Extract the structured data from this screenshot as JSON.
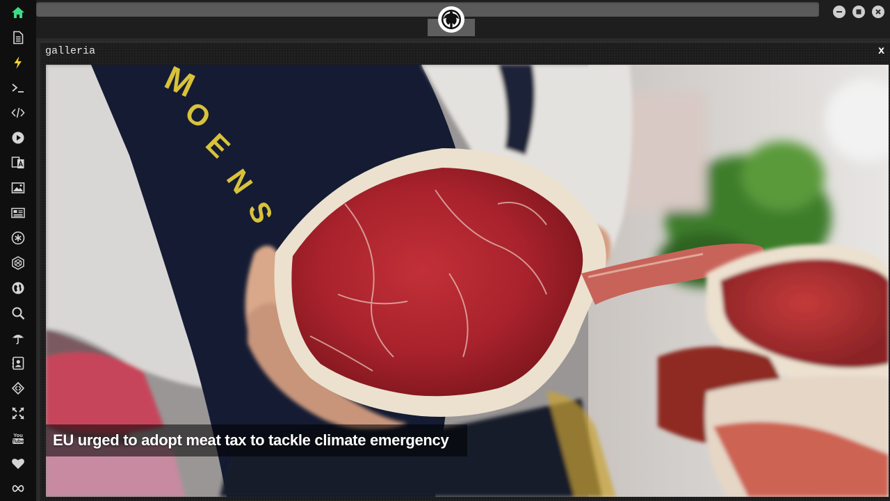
{
  "sidebar": {
    "items": [
      {
        "name": "home-icon",
        "color": "#3ddc84"
      },
      {
        "name": "document-icon"
      },
      {
        "name": "lightning-icon",
        "color": "#f5d02f"
      },
      {
        "name": "terminal-icon"
      },
      {
        "name": "code-icon"
      },
      {
        "name": "play-icon"
      },
      {
        "name": "translate-icon"
      },
      {
        "name": "image-icon"
      },
      {
        "name": "newspaper-icon"
      },
      {
        "name": "asterisk-icon"
      },
      {
        "name": "hexagon-icon"
      },
      {
        "name": "globe-icon"
      },
      {
        "name": "search-icon"
      },
      {
        "name": "umbrella-icon"
      },
      {
        "name": "contact-card-icon"
      },
      {
        "name": "transfer-icon"
      },
      {
        "name": "fullscreen-icon"
      },
      {
        "name": "youtube-icon"
      },
      {
        "name": "heart-icon"
      },
      {
        "name": "infinity-icon"
      }
    ]
  },
  "window": {
    "logo": "rebel-alliance-icon",
    "buttons": [
      "minimize-icon",
      "maximize-icon",
      "close-icon"
    ]
  },
  "panel": {
    "title": "galleria",
    "close_label": "x"
  },
  "gallery": {
    "caption": "EU urged to adopt meat tax to tackle climate emergency",
    "apron_text": "MOENS"
  },
  "colors": {
    "sidebar_bg": "#0f0f0f",
    "panel_bg": "#1c1c1c",
    "home_icon": "#3ddc84",
    "lightning_icon": "#f5d02f"
  }
}
